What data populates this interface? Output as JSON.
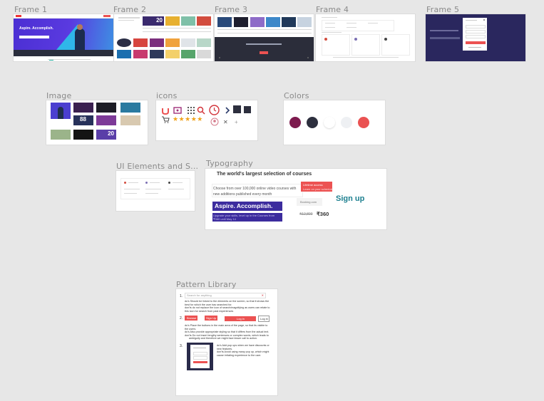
{
  "labels": {
    "frame1": "Frame 1",
    "frame2": "Frame 2",
    "frame3": "Frame 3",
    "frame4": "Frame 4",
    "frame5": "Frame 5",
    "image": "Image",
    "icons": "icons",
    "colors": "Colors",
    "ui_elements": "UI Elements and S...",
    "typography": "Typography",
    "pattern_library": "Pattern Library"
  },
  "frame1": {
    "hero_title": "Aspire. Accomplish."
  },
  "frame2": {
    "badge": "20"
  },
  "image_panel": {
    "badge1": "88",
    "badge2": "20"
  },
  "icons_panel": {
    "stars": "★★★★★"
  },
  "colors": {
    "swatches": [
      "#7d1a4e",
      "#2d2f3e",
      "#ffffff",
      "#eef0f3",
      "#ea5252"
    ]
  },
  "typography": {
    "heading": "The world's largest selection of courses",
    "body": "Choose from over 100,000 online video courses with new additions published every month",
    "promo_title": "Lifetime access",
    "promo_sub": "Learn on your schedule",
    "hero": "Aspire. Accomplish.",
    "signup": "Sign up",
    "booking": "Booking.com",
    "hero_sub": "Upgrade your skills, level up in the Courses from ₹360 until May 14",
    "old_price": "₹12,800",
    "new_price": "₹360"
  },
  "pattern": {
    "search_placeholder": "Search for anything",
    "n1": "1.",
    "n2": "2.",
    "n3": "3.",
    "b1_line1": "do's Should be linked to the elements on the screen, so that it shows the",
    "b1_line2": "best for which the user has searched for.",
    "b1_line3": "don'ts do not replace the icon of search/magnifying as users can relate to",
    "b1_line4": "this icon for search from past experiences",
    "browse_btn": "Browse",
    "signup_btn": "Sign Up",
    "login_btn": "Log in",
    "login_small": "Log in",
    "b2_line1": "do's Place the buttons in the main area of the page, so that its visible to",
    "b2_line2": "the users.",
    "b2_line3": "do's Also provide appropriate styling so that it differs from the actual text.",
    "b2_line4": "don'ts Do not insert lengthy sentences or complex words, which leads to",
    "b2_line5": "ambiguity and therefore we might face lesser call to action.",
    "b3_line1": "do's Add pop ups when we have discounts or",
    "b3_line2": "new features.",
    "b3_line3": "don'ts Avoid using many pop up, which might",
    "b3_line4": "cause irritating experience to the user."
  }
}
